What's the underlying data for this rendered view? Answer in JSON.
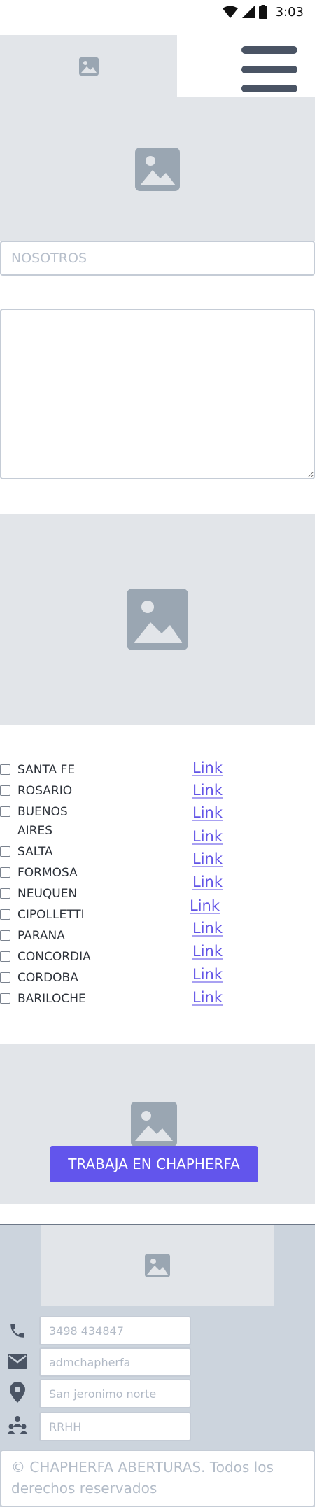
{
  "status_bar": {
    "time": "3:03"
  },
  "about": {
    "title_placeholder": "NOSOTROS"
  },
  "cities": [
    {
      "name": "SANTA FE",
      "link": "Link"
    },
    {
      "name": "ROSARIO",
      "link": "Link"
    },
    {
      "name": "BUENOS AIRES",
      "link": "Link"
    },
    {
      "name": "SALTA",
      "link": "Link"
    },
    {
      "name": "FORMOSA",
      "link": "Link"
    },
    {
      "name": "NEUQUEN",
      "link": "Link"
    },
    {
      "name": "CIPOLLETTI",
      "link": "Link"
    },
    {
      "name": "PARANA",
      "link": "Link"
    },
    {
      "name": "CONCORDIA",
      "link": "Link"
    },
    {
      "name": "CORDOBA",
      "link": "Link"
    },
    {
      "name": "BARILOCHE",
      "link": "Link"
    }
  ],
  "jobs": {
    "button_label": "TRABAJA EN CHAPHERFA"
  },
  "footer": {
    "contacts": [
      {
        "icon": "phone-icon",
        "placeholder": "3498 434847"
      },
      {
        "icon": "mail-icon",
        "placeholder": "admchapherfa"
      },
      {
        "icon": "location-pin-icon",
        "placeholder": "San jeronimo norte"
      },
      {
        "icon": "people-icon",
        "placeholder": "RRHH"
      }
    ],
    "copyright": "© CHAPHERFA ABERTURAS. Todos los derechos reservados"
  },
  "colors": {
    "placeholder_bg": "#e2e5e9",
    "accent": "#6255ec",
    "footer_bg": "#ccd4dd",
    "icon_dark": "#4a5464"
  }
}
